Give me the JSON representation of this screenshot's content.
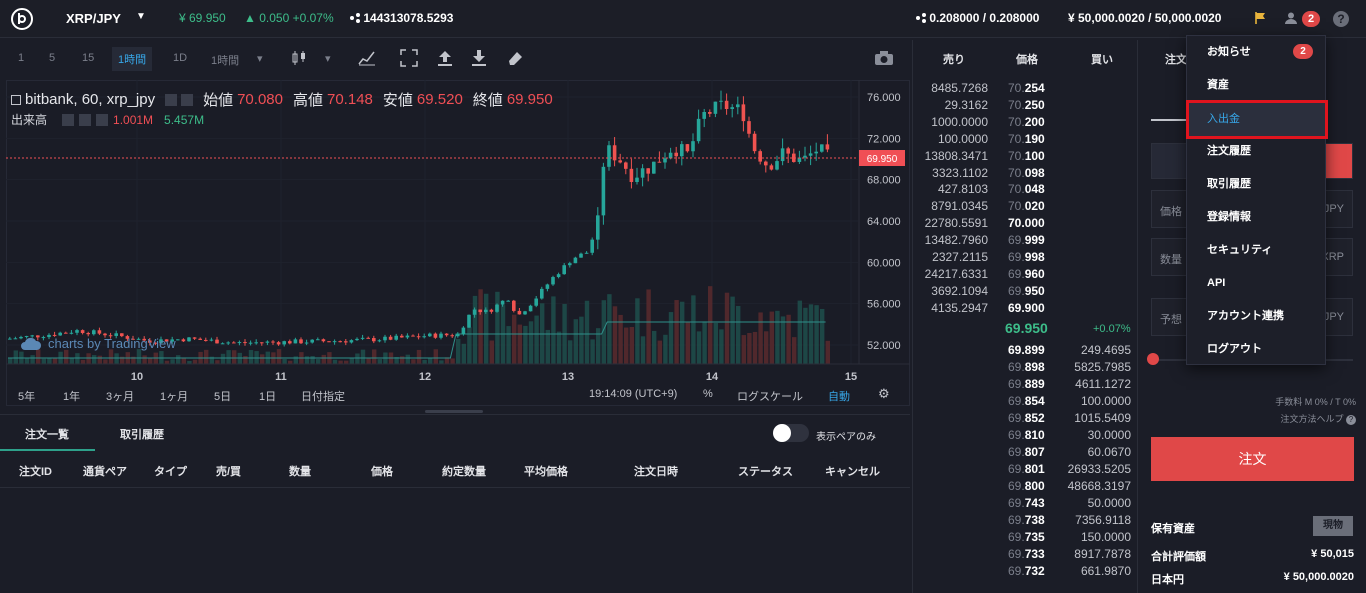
{
  "header": {
    "pair": "XRP/JPY",
    "price": "¥ 69.950",
    "change": "0.050 +0.07%",
    "volume": "144313078.5293",
    "btc_balance": "0.208000 / 0.208000",
    "jpy_balance": "¥ 50,000.0020 / 50,000.0020",
    "notification_count": "2",
    "help": "?"
  },
  "chart_toolbar": {
    "timeframes": [
      "1",
      "5",
      "15",
      "1時間",
      "1D",
      "1時間"
    ],
    "active": "1時間"
  },
  "chart": {
    "legend_symbol": "bitbank, 60, xrp_jpy",
    "open_label": "始値",
    "open_value": "70.080",
    "high_label": "高値",
    "high_value": "70.148",
    "low_label": "安値",
    "low_value": "69.520",
    "close_label": "終値",
    "close_value": "69.950",
    "volume_label": "出来高",
    "volume_value_1": "1.001M",
    "volume_value_2": "5.457M",
    "attribution": "charts by TradingView",
    "current_price_tag": "69.950",
    "y_ticks": [
      "76.000",
      "72.000",
      "68.000",
      "64.000",
      "60.000",
      "56.000",
      "52.000"
    ],
    "x_ticks": [
      "10",
      "11",
      "12",
      "13",
      "14",
      "15"
    ]
  },
  "range_bar": {
    "ranges": [
      "5年",
      "1年",
      "3ヶ月",
      "1ヶ月",
      "5日",
      "1日",
      "日付指定"
    ],
    "time": "19:14:09 (UTC+9)",
    "percent": "%",
    "log_scale": "ログスケール",
    "auto": "自動"
  },
  "orders_panel": {
    "tabs": [
      "注文一覧",
      "取引履歴"
    ],
    "toggle_label": "表示ペアのみ",
    "columns": [
      "注文ID",
      "通貨ペア",
      "タイプ",
      "売/買",
      "数量",
      "価格",
      "約定数量",
      "平均価格",
      "注文日時",
      "ステータス",
      "キャンセル"
    ]
  },
  "orderbook": {
    "headers": [
      "売り",
      "価格",
      "買い"
    ],
    "asks": [
      {
        "amount": "8485.7268",
        "price_dim": "70.",
        "price_bold": "254"
      },
      {
        "amount": "29.3162",
        "price_dim": "70.",
        "price_bold": "250"
      },
      {
        "amount": "1000.0000",
        "price_dim": "70.",
        "price_bold": "200"
      },
      {
        "amount": "100.0000",
        "price_dim": "70.",
        "price_bold": "190"
      },
      {
        "amount": "13808.3471",
        "price_dim": "70.",
        "price_bold": "100"
      },
      {
        "amount": "3323.1102",
        "price_dim": "70.",
        "price_bold": "098"
      },
      {
        "amount": "427.8103",
        "price_dim": "70.",
        "price_bold": "048"
      },
      {
        "amount": "8791.0345",
        "price_dim": "70.",
        "price_bold": "020"
      },
      {
        "amount": "22780.5591",
        "price_dim": "",
        "price_bold": "70.000"
      },
      {
        "amount": "13482.7960",
        "price_dim": "69.",
        "price_bold": "999"
      },
      {
        "amount": "2327.2115",
        "price_dim": "69.",
        "price_bold": "998"
      },
      {
        "amount": "24217.6331",
        "price_dim": "69.",
        "price_bold": "960"
      },
      {
        "amount": "3692.1094",
        "price_dim": "69.",
        "price_bold": "950"
      },
      {
        "amount": "4135.2947",
        "price_dim": "",
        "price_bold": "69.900"
      }
    ],
    "last_price": "69.950",
    "last_change": "+0.07%",
    "bids": [
      {
        "price_dim": "",
        "price_bold": "69.899",
        "amount": "249.4695"
      },
      {
        "price_dim": "69.",
        "price_bold": "898",
        "amount": "5825.7985"
      },
      {
        "price_dim": "69.",
        "price_bold": "889",
        "amount": "4611.1272"
      },
      {
        "price_dim": "69.",
        "price_bold": "854",
        "amount": "100.0000"
      },
      {
        "price_dim": "69.",
        "price_bold": "852",
        "amount": "1015.5409"
      },
      {
        "price_dim": "69.",
        "price_bold": "810",
        "amount": "30.0000"
      },
      {
        "price_dim": "69.",
        "price_bold": "807",
        "amount": "60.0670"
      },
      {
        "price_dim": "69.",
        "price_bold": "801",
        "amount": "26933.5205"
      },
      {
        "price_dim": "69.",
        "price_bold": "800",
        "amount": "48668.3197"
      },
      {
        "price_dim": "69.",
        "price_bold": "743",
        "amount": "50.0000"
      },
      {
        "price_dim": "69.",
        "price_bold": "738",
        "amount": "7356.9118"
      },
      {
        "price_dim": "69.",
        "price_bold": "735",
        "amount": "150.0000"
      },
      {
        "price_dim": "69.",
        "price_bold": "733",
        "amount": "8917.7878"
      },
      {
        "price_dim": "69.",
        "price_bold": "732",
        "amount": "661.9870"
      }
    ]
  },
  "order_form": {
    "tab": "注文",
    "price_label": "価格",
    "price_unit": "JPY",
    "qty_label": "数量",
    "qty_unit": "XRP",
    "est_label": "予想",
    "est_unit": "JPY",
    "fee": "手数料 M 0% / T 0%",
    "help_link": "注文方法ヘルプ",
    "submit": "注文",
    "holdings_label": "保有資産",
    "holdings_button": "現物",
    "total_label": "合計評価額",
    "total_value": "¥ 50,015",
    "jpy_label": "日本円",
    "jpy_value": "¥ 50,000.0020"
  },
  "user_menu": {
    "items": [
      "お知らせ",
      "資産",
      "入出金",
      "注文履歴",
      "取引履歴",
      "登録情報",
      "セキュリティ",
      "API",
      "アカウント連携",
      "ログアウト"
    ],
    "badge": "2",
    "highlighted": "入出金"
  },
  "colors": {
    "up": "#3dbd8a",
    "down": "#f04f55",
    "accent": "#37a7e8",
    "highlight_border": "#e0141e"
  }
}
